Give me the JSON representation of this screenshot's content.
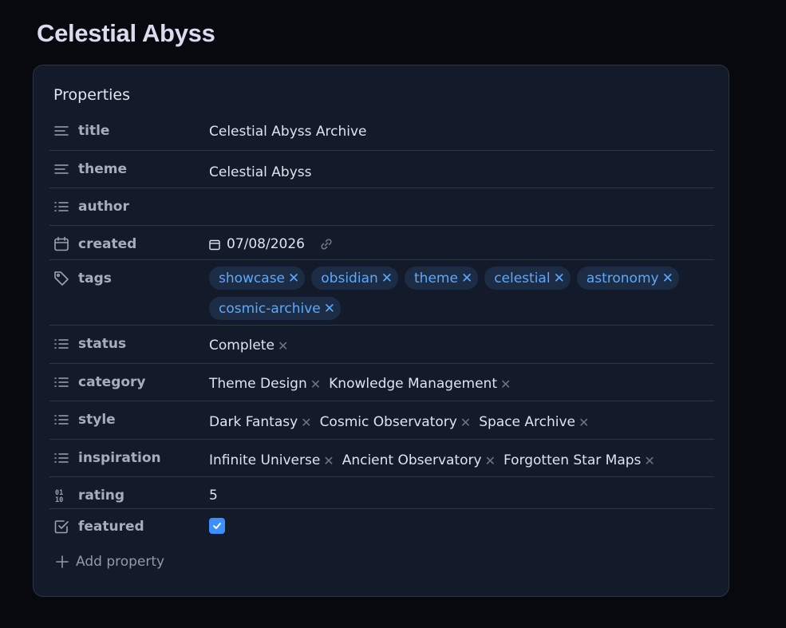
{
  "page": {
    "title": "Celestial Abyss"
  },
  "panel": {
    "heading": "Properties",
    "add_property_label": "Add property",
    "properties": {
      "title": {
        "key": "title",
        "icon": "text-lines-icon",
        "value": "Celestial Abyss Archive"
      },
      "theme": {
        "key": "theme",
        "icon": "text-lines-icon",
        "value": "Celestial Abyss"
      },
      "author": {
        "key": "author",
        "icon": "list-icon",
        "value": ""
      },
      "created": {
        "key": "created",
        "icon": "calendar-icon",
        "value": "07/08/2026"
      },
      "tags": {
        "key": "tags",
        "icon": "tag-icon",
        "values": [
          "showcase",
          "obsidian",
          "theme",
          "celestial",
          "astronomy",
          "cosmic-archive"
        ]
      },
      "status": {
        "key": "status",
        "icon": "list-icon",
        "values": [
          "Complete"
        ]
      },
      "category": {
        "key": "category",
        "icon": "list-icon",
        "values": [
          "Theme Design",
          "Knowledge Management"
        ]
      },
      "style": {
        "key": "style",
        "icon": "list-icon",
        "values": [
          "Dark Fantasy",
          "Cosmic Observatory",
          "Space Archive"
        ]
      },
      "inspiration": {
        "key": "inspiration",
        "icon": "list-icon",
        "values": [
          "Infinite Universe",
          "Ancient Observatory",
          "Forgotten Star Maps"
        ]
      },
      "rating": {
        "key": "rating",
        "icon": "number-icon",
        "value": "5"
      },
      "featured": {
        "key": "featured",
        "icon": "checkbox-icon",
        "checked": true
      }
    }
  },
  "colors": {
    "background": "#07090e",
    "panel": "#131a29",
    "tag_bg": "#1d2c45",
    "tag_text": "#5aa9ff",
    "accent": "#3d8eff"
  }
}
